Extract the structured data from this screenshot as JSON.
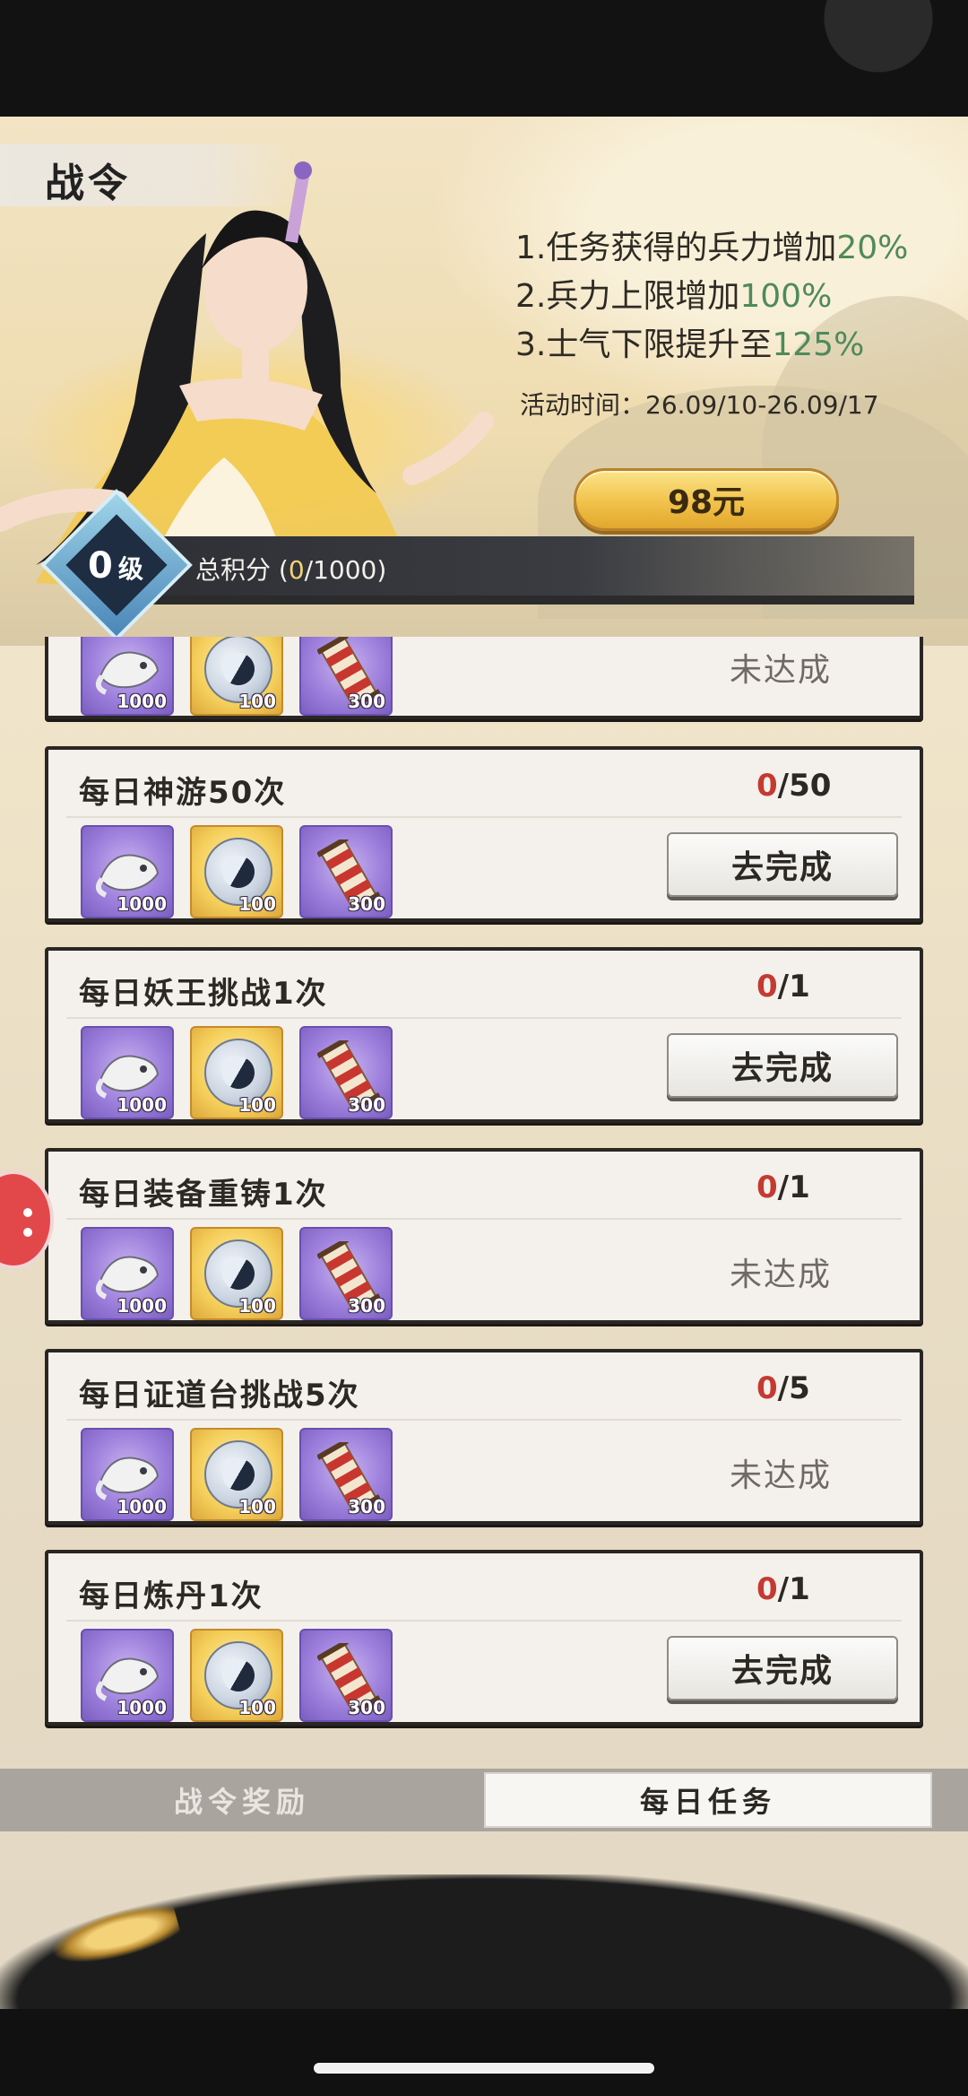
{
  "header": {
    "title": "战令",
    "perks": [
      {
        "prefix": "1.任务获得的兵力增加",
        "highlight": "20%"
      },
      {
        "prefix": "2.兵力上限增加",
        "highlight": "100%"
      },
      {
        "prefix": "3.士气下限提升至",
        "highlight": "125%"
      }
    ],
    "activity_time": "活动时间：26.09/10-26.09/17",
    "price_label": "98元",
    "level_value": "0",
    "level_unit": "级",
    "score_prefix": "总积分 (",
    "score_current": "0",
    "score_suffix": "/1000)"
  },
  "tasks": [
    {
      "title": "",
      "current": "",
      "total": "",
      "status": "未达成",
      "action": ""
    },
    {
      "title": "每日神游50次",
      "current": "0",
      "total": "/50",
      "status": "",
      "action": "去完成"
    },
    {
      "title": "每日妖王挑战1次",
      "current": "0",
      "total": "/1",
      "status": "",
      "action": "去完成"
    },
    {
      "title": "每日装备重铸1次",
      "current": "0",
      "total": "/1",
      "status": "未达成",
      "action": ""
    },
    {
      "title": "每日证道台挑战5次",
      "current": "0",
      "total": "/5",
      "status": "未达成",
      "action": ""
    },
    {
      "title": "每日炼丹1次",
      "current": "0",
      "total": "/1",
      "status": "",
      "action": "去完成"
    }
  ],
  "rewards": [
    {
      "icon": "spirit-beast-icon",
      "qty": "1000"
    },
    {
      "icon": "taiji-stone-icon",
      "qty": "100"
    },
    {
      "icon": "scroll-icon",
      "qty": "300"
    }
  ],
  "tabs": {
    "rewards_tab": "战令奖励",
    "daily_tab": "每日任务"
  },
  "colors": {
    "highlight_green": "#4e8a5a",
    "progress_red": "#c43a32",
    "gold_button": "#f1c24a"
  }
}
